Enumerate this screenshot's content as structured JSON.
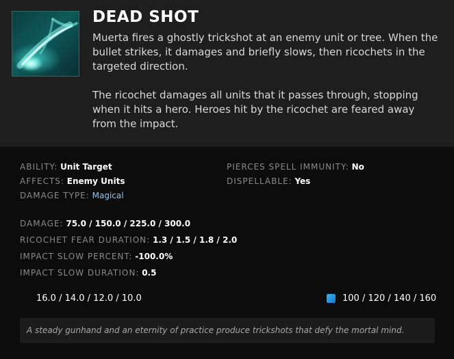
{
  "ability": {
    "name": "DEAD SHOT",
    "icon": "dead-shot-icon",
    "description": [
      "Muerta fires a ghostly trickshot at an enemy unit or tree. When the bullet strikes, it damages and briefly slows, then ricochets in the targeted direction.",
      "The ricochet damages all units that it passes through, stopping when it hits a hero. Heroes hit by the ricochet are feared away from the impact."
    ]
  },
  "info": {
    "ability": {
      "label": "ABILITY:",
      "value": "Unit Target"
    },
    "affects": {
      "label": "AFFECTS:",
      "value": "Enemy Units"
    },
    "damage_type": {
      "label": "DAMAGE TYPE:",
      "value": "Magical"
    },
    "pierces": {
      "label": "PIERCES SPELL IMMUNITY:",
      "value": "No"
    },
    "dispellable": {
      "label": "DISPELLABLE:",
      "value": "Yes"
    }
  },
  "attributes": [
    {
      "label": "DAMAGE:",
      "value": "75.0 / 150.0 / 225.0 / 300.0"
    },
    {
      "label": "RICOCHET FEAR DURATION:",
      "value": "1.3 / 1.5 / 1.8 / 2.0"
    },
    {
      "label": "IMPACT SLOW PERCENT:",
      "value": "-100.0%"
    },
    {
      "label": "IMPACT SLOW DURATION:",
      "value": "0.5"
    }
  ],
  "cooldown": "16.0 / 14.0 / 12.0 / 10.0",
  "mana": "100 / 120 / 140 / 160",
  "lore": "A steady gunhand and an eternity of practice produce trickshots that defy the mortal mind.",
  "colors": {
    "header_bg": "#1e1e1e",
    "body_bg": "#0c0c0c",
    "magical": "#8fc6ee",
    "mana": "#2a9ae0"
  }
}
